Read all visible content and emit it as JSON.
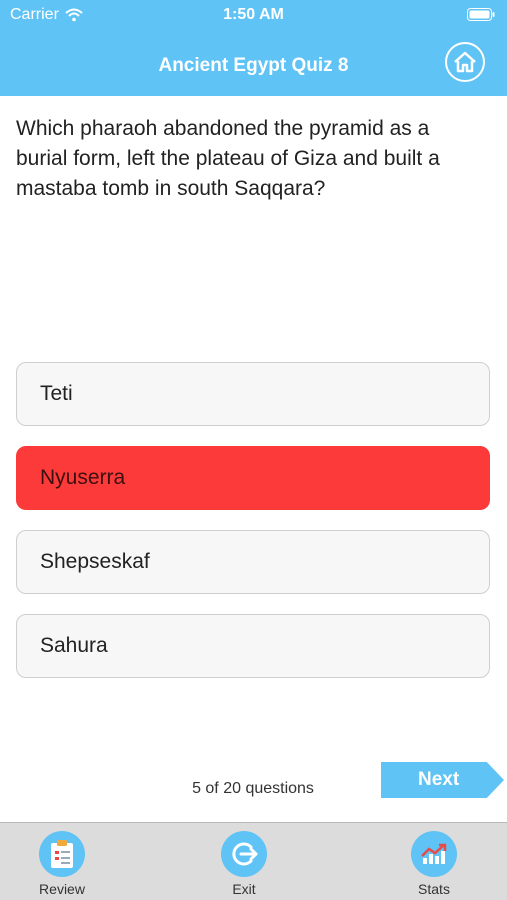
{
  "status_bar": {
    "carrier": "Carrier",
    "time": "1:50 AM"
  },
  "header": {
    "title": "Ancient Egypt Quiz 8",
    "home_icon": "home-icon"
  },
  "question": {
    "text": "Which pharaoh abandoned the pyramid as a burial form, left the plateau of Giza and built a mastaba tomb in south Saqqara?"
  },
  "answers": [
    {
      "label": "Teti",
      "state": "normal"
    },
    {
      "label": "Nyuserra",
      "state": "wrong"
    },
    {
      "label": "Shepseskaf",
      "state": "normal"
    },
    {
      "label": "Sahura",
      "state": "normal"
    }
  ],
  "footer": {
    "progress": "5 of 20 questions",
    "next_label": "Next"
  },
  "tabs": [
    {
      "label": "Review",
      "icon": "clipboard-icon"
    },
    {
      "label": "Exit",
      "icon": "exit-icon"
    },
    {
      "label": "Stats",
      "icon": "chart-icon"
    }
  ],
  "colors": {
    "accent": "#5fc3f5",
    "wrong": "#fc3a3a",
    "answer_bg": "#f7f7f7",
    "tabbar_bg": "#dcdcdc"
  }
}
